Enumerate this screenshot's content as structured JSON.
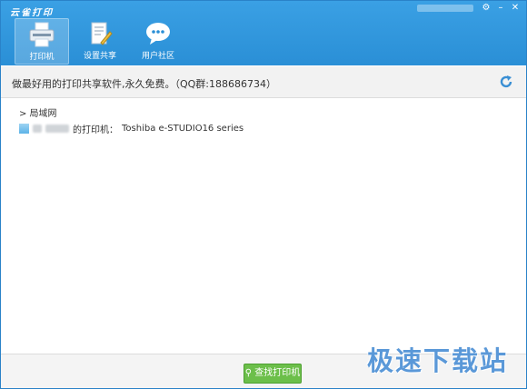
{
  "app": {
    "title": "云雀打印"
  },
  "toolbar": {
    "tabs": [
      {
        "label": "打印机",
        "icon": "printer-icon",
        "active": true
      },
      {
        "label": "设置共享",
        "icon": "document-share-icon",
        "active": false
      },
      {
        "label": "用户社区",
        "icon": "chat-bubble-icon",
        "active": false
      }
    ]
  },
  "window_controls": {
    "settings": "⚙",
    "minimize": "–",
    "close": "✕"
  },
  "banner": {
    "slogan": "做最好用的打印共享软件,永久免费。（QQ群:188686734）",
    "refresh_icon": "refresh-icon"
  },
  "network": {
    "group_label": "> 局域网",
    "printers": [
      {
        "suffix": "的打印机：",
        "model": "Toshiba e-STUDIO16 series"
      }
    ]
  },
  "footer": {
    "find_button": "查找打印机",
    "find_icon": "search-icon"
  },
  "watermark": "极速下载站",
  "colors": {
    "header": "#2a8fd6",
    "accent_green": "#6cbf4a",
    "watermark": "#5a98d8"
  }
}
